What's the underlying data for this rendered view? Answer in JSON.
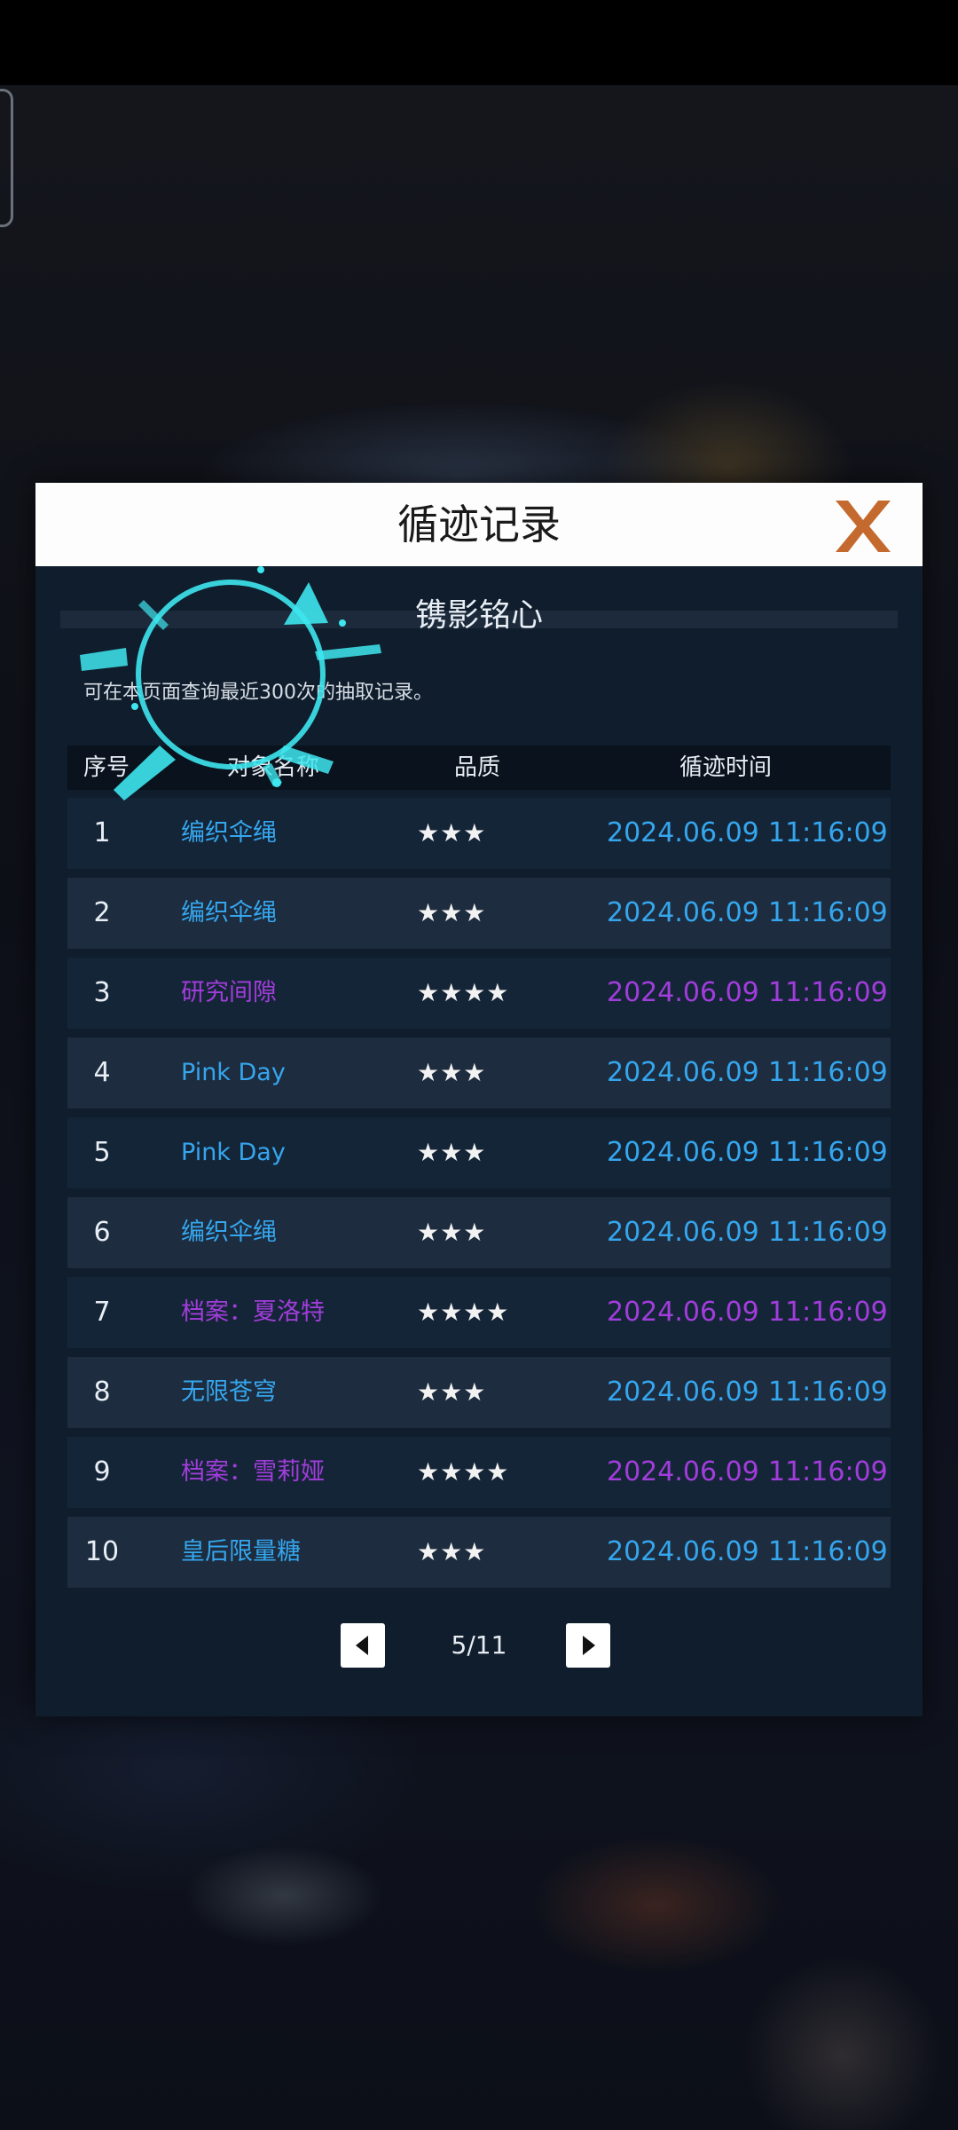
{
  "dialog": {
    "title": "循迹记录",
    "pool_name": "镌影铭心",
    "hint": "可在本页面查询最近300次的抽取记录。"
  },
  "columns": {
    "index": "序号",
    "name": "对象名称",
    "quality": "品质",
    "time": "循迹时间"
  },
  "records": [
    {
      "index": "1",
      "name": "编织伞绳",
      "stars": "★★★",
      "date": "2024.06.09",
      "time": "11:16:09",
      "rarity": 3
    },
    {
      "index": "2",
      "name": "编织伞绳",
      "stars": "★★★",
      "date": "2024.06.09",
      "time": "11:16:09",
      "rarity": 3
    },
    {
      "index": "3",
      "name": "研究间隙",
      "stars": "★★★★",
      "date": "2024.06.09",
      "time": "11:16:09",
      "rarity": 4
    },
    {
      "index": "4",
      "name": "Pink Day",
      "stars": "★★★",
      "date": "2024.06.09",
      "time": "11:16:09",
      "rarity": 3
    },
    {
      "index": "5",
      "name": "Pink Day",
      "stars": "★★★",
      "date": "2024.06.09",
      "time": "11:16:09",
      "rarity": 3
    },
    {
      "index": "6",
      "name": "编织伞绳",
      "stars": "★★★",
      "date": "2024.06.09",
      "time": "11:16:09",
      "rarity": 3
    },
    {
      "index": "7",
      "name": "档案：夏洛特",
      "stars": "★★★★",
      "date": "2024.06.09",
      "time": "11:16:09",
      "rarity": 4
    },
    {
      "index": "8",
      "name": "无限苍穹",
      "stars": "★★★",
      "date": "2024.06.09",
      "time": "11:16:09",
      "rarity": 3
    },
    {
      "index": "9",
      "name": "档案：雪莉娅",
      "stars": "★★★★",
      "date": "2024.06.09",
      "time": "11:16:09",
      "rarity": 4
    },
    {
      "index": "10",
      "name": "皇后限量糖",
      "stars": "★★★",
      "date": "2024.06.09",
      "time": "11:16:09",
      "rarity": 3
    }
  ],
  "pagination": {
    "page_label": "5/11",
    "prev_icon": "triangle-left-icon",
    "next_icon": "triangle-right-icon"
  },
  "colors": {
    "rarity3": "#35a6ee",
    "rarity4": "#a13ddb",
    "close_icon": "#c46a2f",
    "touch_ring": "#3ee6ee"
  }
}
